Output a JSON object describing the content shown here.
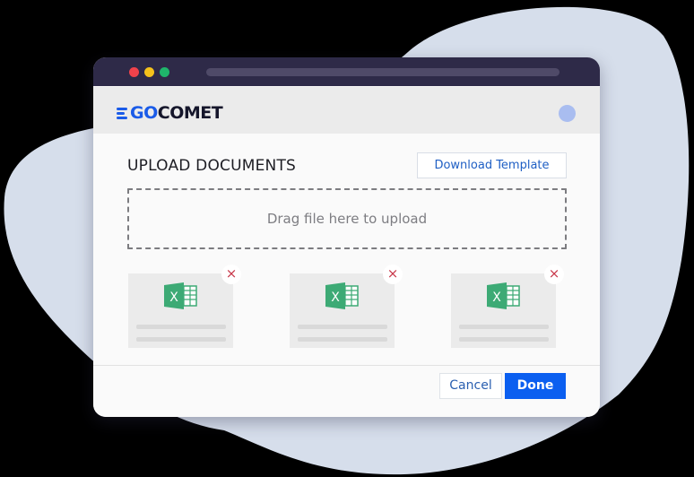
{
  "background": {
    "blob_color": "#d6deeb"
  },
  "window": {
    "controls": [
      "close",
      "minimize",
      "maximize"
    ]
  },
  "header": {
    "logo_prefix": "GO",
    "logo_suffix": "COMET",
    "brand_color": "#1a5be8"
  },
  "upload": {
    "title": "UPLOAD DOCUMENTS",
    "download_template_label": "Download Template",
    "dropzone_text": "Drag file here to upload"
  },
  "files": [
    {
      "type": "excel-file-icon",
      "remove_label": "×"
    },
    {
      "type": "excel-file-icon",
      "remove_label": "×"
    },
    {
      "type": "excel-file-icon",
      "remove_label": "×"
    }
  ],
  "footer": {
    "cancel_label": "Cancel",
    "done_label": "Done",
    "accent_color": "#0b5ff0"
  }
}
